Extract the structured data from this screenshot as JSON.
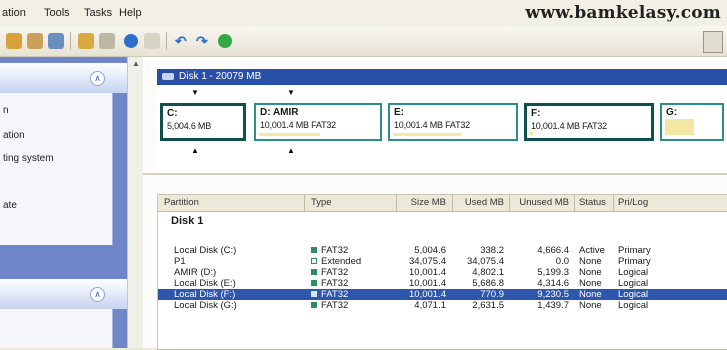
{
  "menu": [
    "ation",
    "Tools",
    "Tasks",
    "Help"
  ],
  "watermark": "www.bamkelasy.com",
  "left_panel": {
    "items_top": [
      "n",
      "ation",
      "ting system"
    ],
    "item_lone": "ate"
  },
  "disk_bar_label": "Disk 1 - 20079 MB",
  "partitions": [
    {
      "name": "C:",
      "info": "5,004.6 MB"
    },
    {
      "name": "D:  AMIR",
      "info": "10,001.4 MB    FAT32"
    },
    {
      "name": "E:",
      "info": "10,001.4 MB    FAT32"
    },
    {
      "name": "F:",
      "info": "10,001.4 MB    FAT32"
    },
    {
      "name": "G:",
      "info": ""
    }
  ],
  "table": {
    "headers": [
      "Partition",
      "Type",
      "Size MB",
      "Used MB",
      "Unused MB",
      "Status",
      "Pri/Log"
    ],
    "group": "Disk 1",
    "rows": [
      {
        "partition": "Local Disk (C:)",
        "type": "FAT32",
        "size": "5,004.6",
        "used": "338.2",
        "unused": "4,666.4",
        "status": "Active",
        "prilog": "Primary"
      },
      {
        "partition": "P1",
        "type": "Extended",
        "size": "34,075.4",
        "used": "34,075.4",
        "unused": "0.0",
        "status": "None",
        "prilog": "Primary"
      },
      {
        "partition": "AMIR (D:)",
        "type": "FAT32",
        "size": "10,001.4",
        "used": "4,802.1",
        "unused": "5,199.3",
        "status": "None",
        "prilog": "Logical"
      },
      {
        "partition": "Local Disk (E:)",
        "type": "FAT32",
        "size": "10,001.4",
        "used": "5,686.8",
        "unused": "4,314.6",
        "status": "None",
        "prilog": "Logical"
      },
      {
        "partition": "Local Disk (F:)",
        "type": "FAT32",
        "size": "10,001.4",
        "used": "770.9",
        "unused": "9,230.5",
        "status": "None",
        "prilog": "Logical"
      },
      {
        "partition": "Local Disk (G:)",
        "type": "FAT32",
        "size": "4,071.1",
        "used": "2,631.5",
        "unused": "1,439.7",
        "status": "None",
        "prilog": "Logical"
      }
    ]
  }
}
